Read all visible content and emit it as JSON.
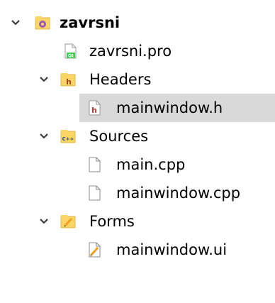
{
  "project": {
    "name": "zavrsni",
    "icon": "qt-project-icon",
    "pro_file": {
      "label": "zavrsni.pro",
      "icon": "qt-pro-file-icon"
    },
    "groups": [
      {
        "label": "Headers",
        "icon": "header-folder-icon",
        "expanded": true,
        "files": [
          {
            "label": "mainwindow.h",
            "icon": "header-file-icon",
            "selected": true
          }
        ]
      },
      {
        "label": "Sources",
        "icon": "cpp-folder-icon",
        "expanded": true,
        "files": [
          {
            "label": "main.cpp",
            "icon": "file-icon"
          },
          {
            "label": "mainwindow.cpp",
            "icon": "file-icon"
          }
        ]
      },
      {
        "label": "Forms",
        "icon": "forms-folder-icon",
        "expanded": true,
        "files": [
          {
            "label": "mainwindow.ui",
            "icon": "ui-file-icon"
          }
        ]
      }
    ]
  },
  "colors": {
    "selection": "#d9d9d9",
    "folder": "#fcd567",
    "project_gear": "#9b59b6",
    "qt_green": "#41cd52",
    "header_h": "#b03a2e",
    "pencil": "#f0a020"
  }
}
